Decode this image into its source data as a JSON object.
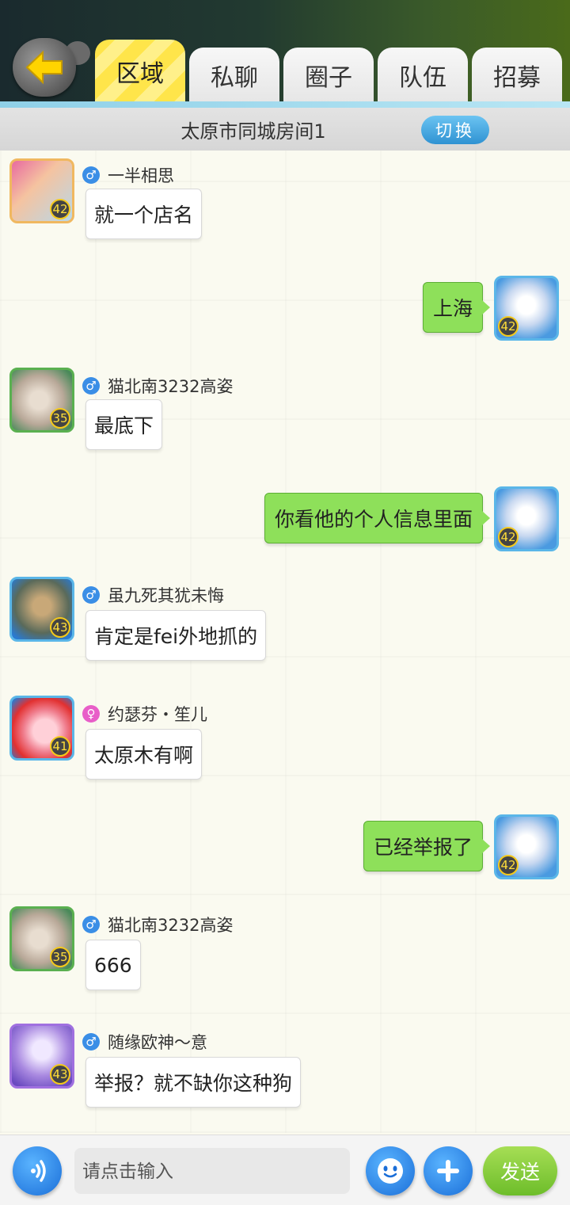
{
  "header": {
    "tabs": [
      {
        "label": "区域",
        "active": true
      },
      {
        "label": "私聊",
        "active": false
      },
      {
        "label": "圈子",
        "active": false
      },
      {
        "label": "队伍",
        "active": false
      },
      {
        "label": "招募",
        "active": false
      }
    ]
  },
  "location": {
    "room": "太原市同城房间1",
    "switch_label": "切换"
  },
  "messages": [
    {
      "side": "left",
      "gender": "male",
      "name": "一半相思",
      "level": "42",
      "text": "就一个店名"
    },
    {
      "side": "right",
      "level": "42",
      "text": "上海"
    },
    {
      "side": "left",
      "gender": "male",
      "name": "猫北南3232高姿",
      "level": "35",
      "text": "最底下"
    },
    {
      "side": "right",
      "level": "42",
      "text": "你看他的个人信息里面"
    },
    {
      "side": "left",
      "gender": "male",
      "name": "虽九死其犹未悔",
      "level": "43",
      "text": "肯定是fei外地抓的"
    },
    {
      "side": "left",
      "gender": "female",
      "name": "约瑟芬・笙儿",
      "level": "41",
      "text": "太原木有啊"
    },
    {
      "side": "right",
      "level": "42",
      "text": "已经举报了"
    },
    {
      "side": "left",
      "gender": "male",
      "name": "猫北南3232高姿",
      "level": "35",
      "text": "666"
    },
    {
      "side": "left",
      "gender": "male",
      "name": "随缘欧神～意",
      "level": "43",
      "text": "举报？就不缺你这种狗"
    }
  ],
  "gender_symbols": {
    "male": "♂",
    "female": "♀"
  },
  "input": {
    "placeholder": "请点击输入",
    "send_label": "发送"
  },
  "colors": {
    "accent_blue": "#2f92d2",
    "my_bubble": "#8ee05a",
    "active_tab": "#ffe54a"
  }
}
